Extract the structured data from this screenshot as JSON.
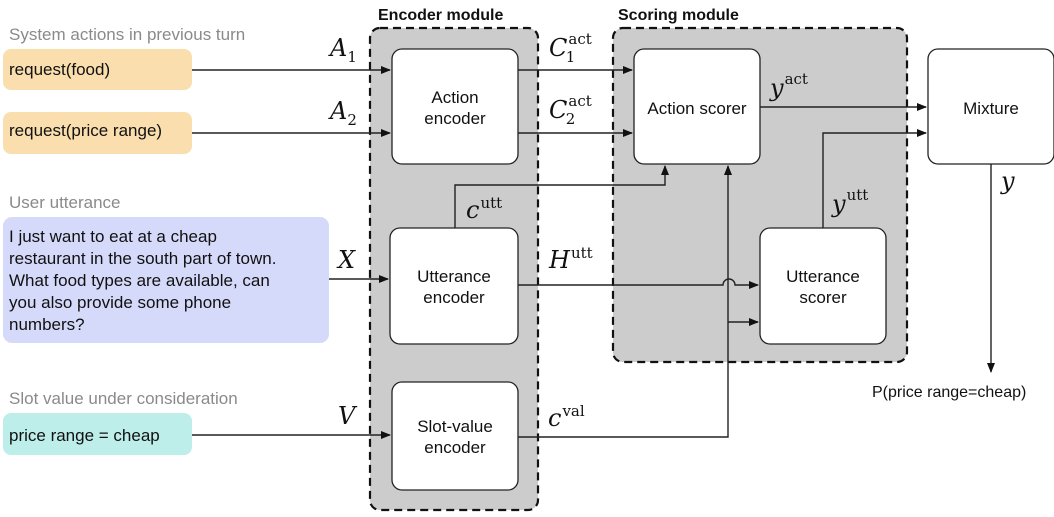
{
  "sections": {
    "system_actions": "System actions in previous turn",
    "user_utterance": "User utterance",
    "slot_value": "Slot value under consideration"
  },
  "inputs": {
    "action1": "request(food)",
    "action2": "request(price range)",
    "utterance_lines": [
      "I just want to eat at a cheap",
      "restaurant in the south part of town.",
      "What food types are available, can",
      "you also provide some phone",
      "numbers?"
    ],
    "slot_value": "price range = cheap"
  },
  "modules": {
    "encoder_title": "Encoder module",
    "scoring_title": "Scoring module"
  },
  "boxes": {
    "action_encoder": [
      "Action",
      "encoder"
    ],
    "utterance_encoder": [
      "Utterance",
      "encoder"
    ],
    "slot_value_encoder": [
      "Slot-value",
      "encoder"
    ],
    "action_scorer": [
      "Action scorer"
    ],
    "utterance_scorer": [
      "Utterance",
      "scorer"
    ],
    "mixture": [
      "Mixture"
    ]
  },
  "variables": {
    "A1": {
      "base": "A",
      "sub": "1"
    },
    "A2": {
      "base": "A",
      "sub": "2"
    },
    "X": {
      "base": "X"
    },
    "V": {
      "base": "V"
    },
    "C1act": {
      "base": "C",
      "sub": "1",
      "sup": "act"
    },
    "C2act": {
      "base": "C",
      "sub": "2",
      "sup": "act"
    },
    "cutt": {
      "base": "c",
      "sup": "utt"
    },
    "Hutt": {
      "base": "H",
      "sup": "utt"
    },
    "cval": {
      "base": "c",
      "sup": "val"
    },
    "yact": {
      "base": "y",
      "sup": "act"
    },
    "yutt": {
      "base": "y",
      "sup": "utt"
    },
    "y": {
      "base": "y"
    }
  },
  "output": "P(price range=cheap)",
  "colors": {
    "action_input": "#fadeae",
    "utterance_input": "#d6dafa",
    "slot_input": "#bdeeea",
    "module_fill": "#cccccc",
    "section_label": "#8a8a8a"
  }
}
